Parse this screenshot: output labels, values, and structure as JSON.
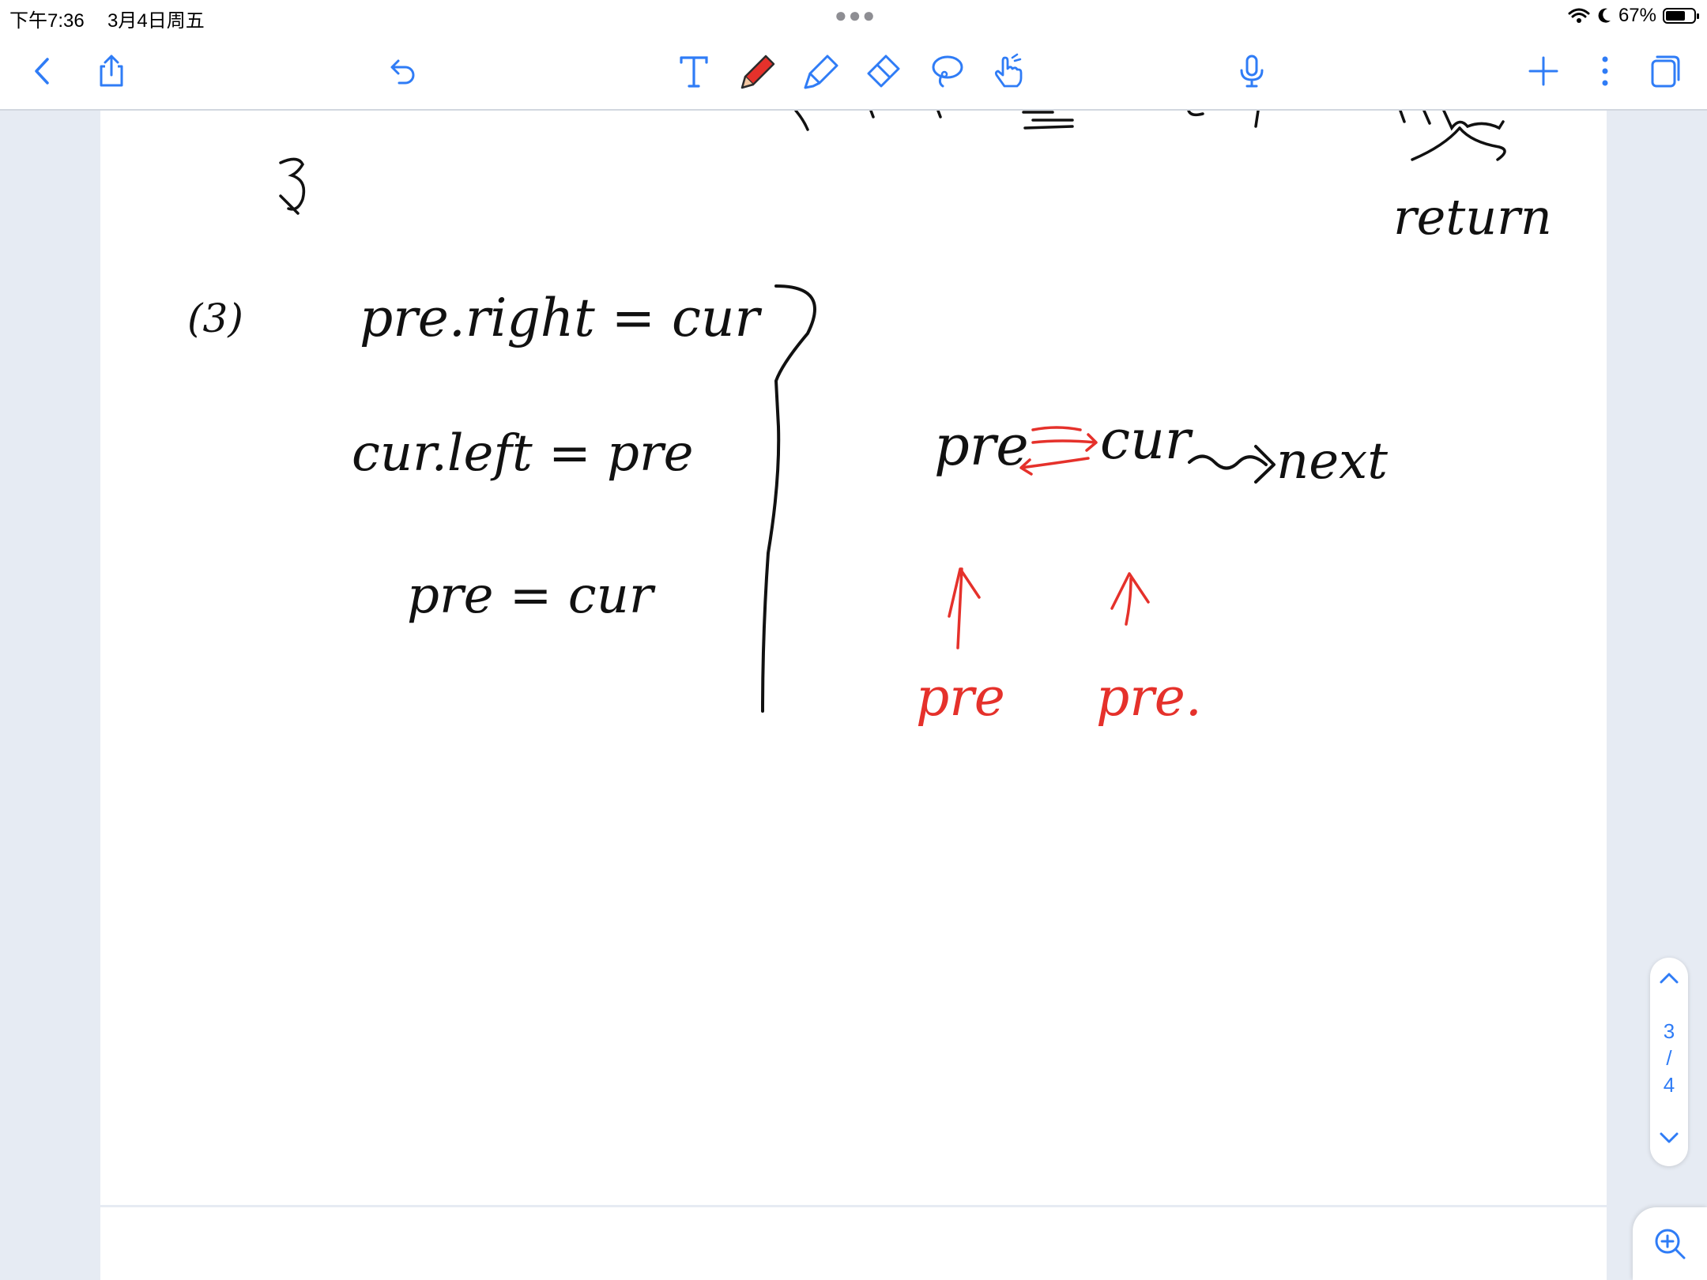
{
  "status_bar": {
    "time": "下午7:36",
    "date": "3月4日周五",
    "battery": "67%",
    "battery_level": 0.67
  },
  "toolbar": {
    "left_icons": [
      "chevron-left-icon",
      "share-icon",
      "undo-icon"
    ],
    "tool_icons": [
      "text-tool-icon",
      "pen-tool-icon",
      "highlighter-tool-icon",
      "eraser-tool-icon",
      "lasso-tool-icon",
      "pointer-hand-icon"
    ],
    "right_icons": [
      "microphone-icon",
      "plus-icon",
      "more-options-icon",
      "pages-icon"
    ],
    "accent_color": "#2f7cf6",
    "pen_color": "#e5312b"
  },
  "notes": {
    "top_label": "return",
    "section_marker": "(3)",
    "line1": "pre.right = cur",
    "line2": "cur.left = pre",
    "line3": "pre = cur",
    "diagram_nodes": [
      "pre",
      "cur",
      "next"
    ],
    "pointer_labels": [
      "pre",
      "pre."
    ],
    "ink_color": "#000000",
    "annotation_color": "#e5312b"
  },
  "pager": {
    "current": "3",
    "separator": "/",
    "total": "4"
  }
}
